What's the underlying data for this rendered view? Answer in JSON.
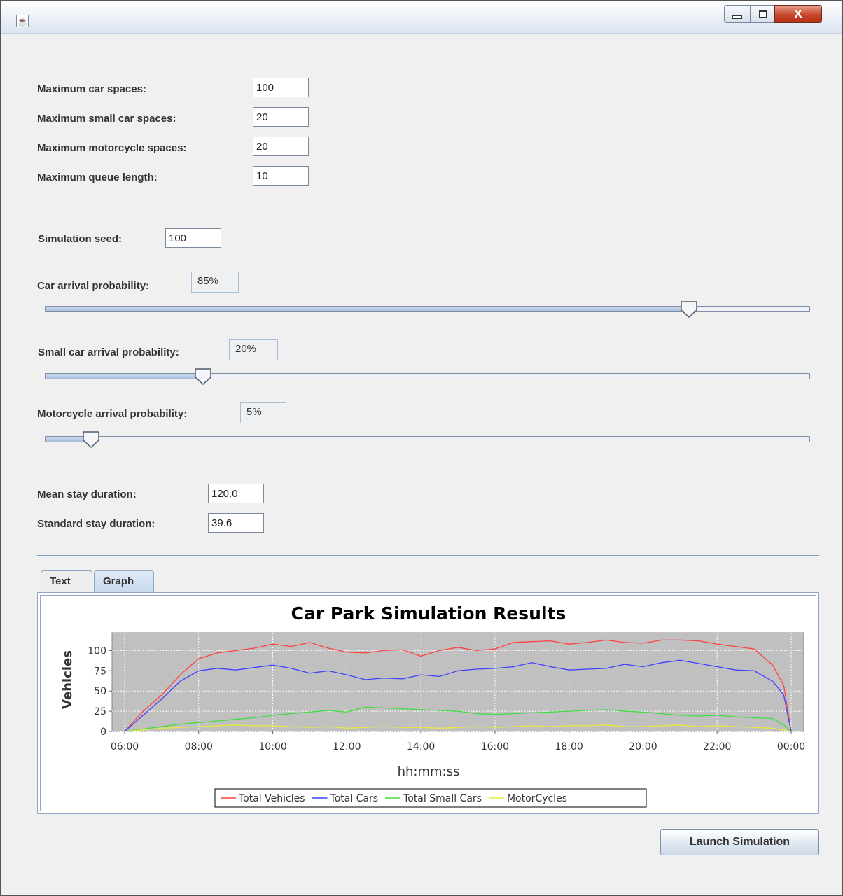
{
  "window": {
    "icons": {
      "app": "java-icon",
      "minimize": "minimize-icon",
      "maximize": "maximize-icon",
      "close": "close-icon"
    },
    "close_glyph": "X"
  },
  "capacity": {
    "max_car_spaces": {
      "label": "Maximum car spaces:",
      "value": "100"
    },
    "max_small_car_spaces": {
      "label": "Maximum small car spaces:",
      "value": "20"
    },
    "max_motorcycle_spaces": {
      "label": "Maximum motorcycle spaces:",
      "value": "20"
    },
    "max_queue_length": {
      "label": "Maximum queue length:",
      "value": "10"
    }
  },
  "simulation": {
    "seed": {
      "label": "Simulation seed:",
      "value": "100"
    },
    "car_arrival": {
      "label": "Car arrival probability:",
      "display": "85%",
      "percent": 85
    },
    "small_car_arrival": {
      "label": "Small car arrival probability:",
      "display": "20%",
      "percent": 20
    },
    "motorcycle_arrival": {
      "label": "Motorcycle arrival probability:",
      "display": "5%",
      "percent": 5
    },
    "mean_stay": {
      "label": "Mean stay duration:",
      "value": "120.0"
    },
    "std_stay": {
      "label": "Standard stay duration:",
      "value": "39.6"
    }
  },
  "tabs": [
    {
      "label": "Text",
      "selected": false
    },
    {
      "label": "Graph",
      "selected": true
    }
  ],
  "launch_button": "Launch Simulation",
  "chart_data": {
    "type": "line",
    "title": "Car Park Simulation Results",
    "xlabel": "hh:mm:ss",
    "ylabel": "Vehicles",
    "x_ticks": [
      "06:00",
      "08:00",
      "10:00",
      "12:00",
      "14:00",
      "16:00",
      "18:00",
      "20:00",
      "22:00",
      "00:00"
    ],
    "y_ticks": [
      0,
      25,
      50,
      75,
      100
    ],
    "xlim": [
      6,
      24
    ],
    "ylim": [
      0,
      122
    ],
    "grid": true,
    "legend_position": "bottom",
    "series": [
      {
        "name": "Total Vehicles",
        "color": "#ff4040",
        "x": [
          6,
          6.5,
          7,
          7.5,
          8,
          8.5,
          9,
          9.5,
          10,
          10.5,
          11,
          11.5,
          12,
          12.5,
          13,
          13.5,
          14,
          14.5,
          15,
          15.5,
          16,
          16.5,
          17,
          17.5,
          18,
          18.5,
          19,
          19.5,
          20,
          20.5,
          21,
          21.5,
          22,
          22.5,
          23,
          23.5,
          23.8,
          24
        ],
        "y": [
          0,
          25,
          45,
          70,
          90,
          97,
          100,
          103,
          108,
          105,
          110,
          103,
          98,
          97,
          100,
          101,
          93,
          100,
          104,
          100,
          102,
          110,
          111,
          112,
          108,
          110,
          113,
          110,
          109,
          113,
          113,
          112,
          108,
          105,
          102,
          82,
          57,
          0
        ]
      },
      {
        "name": "Total Cars",
        "color": "#4040ff",
        "x": [
          6,
          6.5,
          7,
          7.5,
          8,
          8.5,
          9,
          9.5,
          10,
          10.5,
          11,
          11.5,
          12,
          12.5,
          13,
          13.5,
          14,
          14.5,
          15,
          15.5,
          16,
          16.5,
          17,
          17.5,
          18,
          18.5,
          19,
          19.5,
          20,
          20.5,
          21,
          21.5,
          22,
          22.5,
          23,
          23.5,
          23.8,
          24
        ],
        "y": [
          0,
          20,
          40,
          62,
          75,
          78,
          76,
          79,
          82,
          78,
          72,
          75,
          70,
          64,
          66,
          65,
          70,
          68,
          75,
          77,
          78,
          80,
          85,
          80,
          76,
          77,
          78,
          83,
          80,
          85,
          88,
          84,
          80,
          76,
          75,
          62,
          45,
          0
        ]
      },
      {
        "name": "Total Small Cars",
        "color": "#40dd40",
        "x": [
          6,
          6.5,
          7,
          7.5,
          8,
          8.5,
          9,
          9.5,
          10,
          10.5,
          11,
          11.5,
          12,
          12.5,
          13,
          13.5,
          14,
          14.5,
          15,
          15.5,
          16,
          16.5,
          17,
          17.5,
          18,
          18.5,
          19,
          19.5,
          20,
          20.5,
          21,
          21.5,
          22,
          22.5,
          23,
          23.5,
          23.8,
          24
        ],
        "y": [
          0,
          3,
          6,
          9,
          11,
          13,
          15,
          17,
          20,
          22,
          24,
          26,
          24,
          30,
          29,
          28,
          27,
          26,
          25,
          22,
          21,
          22,
          23,
          24,
          25,
          26,
          27,
          25,
          24,
          22,
          20,
          19,
          20,
          18,
          17,
          16,
          8,
          0
        ]
      },
      {
        "name": "MotorCycles",
        "color": "#e8e840",
        "x": [
          6,
          6.5,
          7,
          7.5,
          8,
          8.5,
          9,
          9.5,
          10,
          10.5,
          11,
          11.5,
          12,
          12.5,
          13,
          13.5,
          14,
          14.5,
          15,
          15.5,
          16,
          16.5,
          17,
          17.5,
          18,
          18.5,
          19,
          19.5,
          20,
          20.5,
          21,
          21.5,
          22,
          22.5,
          23,
          23.5,
          23.8,
          24
        ],
        "y": [
          0,
          2,
          4,
          5,
          6,
          7,
          8,
          7,
          7,
          6,
          5,
          6,
          4,
          5,
          6,
          5,
          5,
          4,
          5,
          6,
          5,
          6,
          7,
          6,
          7,
          7,
          8,
          6,
          6,
          7,
          8,
          6,
          7,
          6,
          5,
          4,
          2,
          0
        ]
      }
    ]
  }
}
